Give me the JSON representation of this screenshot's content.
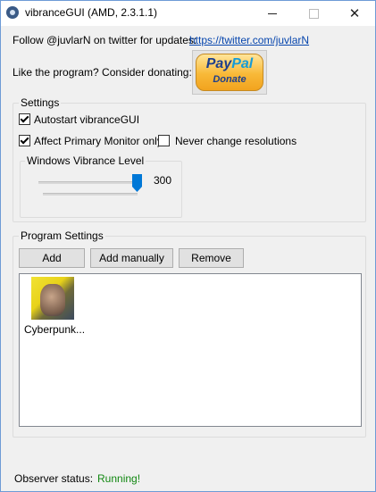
{
  "window": {
    "title": "vibranceGUI (AMD, 2.3.1.1)",
    "close_glyph": "✕"
  },
  "header": {
    "follow_text": "Follow @juvlarN on twitter for updates:",
    "twitter_link": "https://twitter.com/juvlarN",
    "donate_prompt": "Like the program? Consider donating:",
    "paypal": {
      "brand_pay": "Pay",
      "brand_pal": "Pal",
      "donate": "Donate"
    }
  },
  "settings": {
    "group_label": "Settings",
    "autostart": {
      "label": "Autostart vibranceGUI",
      "checked": true
    },
    "affect_primary": {
      "label": "Affect Primary Monitor only",
      "checked": true
    },
    "never_change_res": {
      "label": "Never change resolutions",
      "checked": false
    },
    "vibrance": {
      "group_label": "Windows Vibrance Level",
      "value": "300",
      "level_fraction": 1.0
    }
  },
  "program_settings": {
    "group_label": "Program Settings",
    "buttons": {
      "add": "Add",
      "add_manually": "Add manually",
      "remove": "Remove"
    },
    "programs": [
      {
        "name": "Cyberpunk...",
        "icon": "cyberpunk-game-icon"
      }
    ]
  },
  "status": {
    "label": "Observer status:",
    "value": "Running!",
    "value_color": "#118811"
  }
}
